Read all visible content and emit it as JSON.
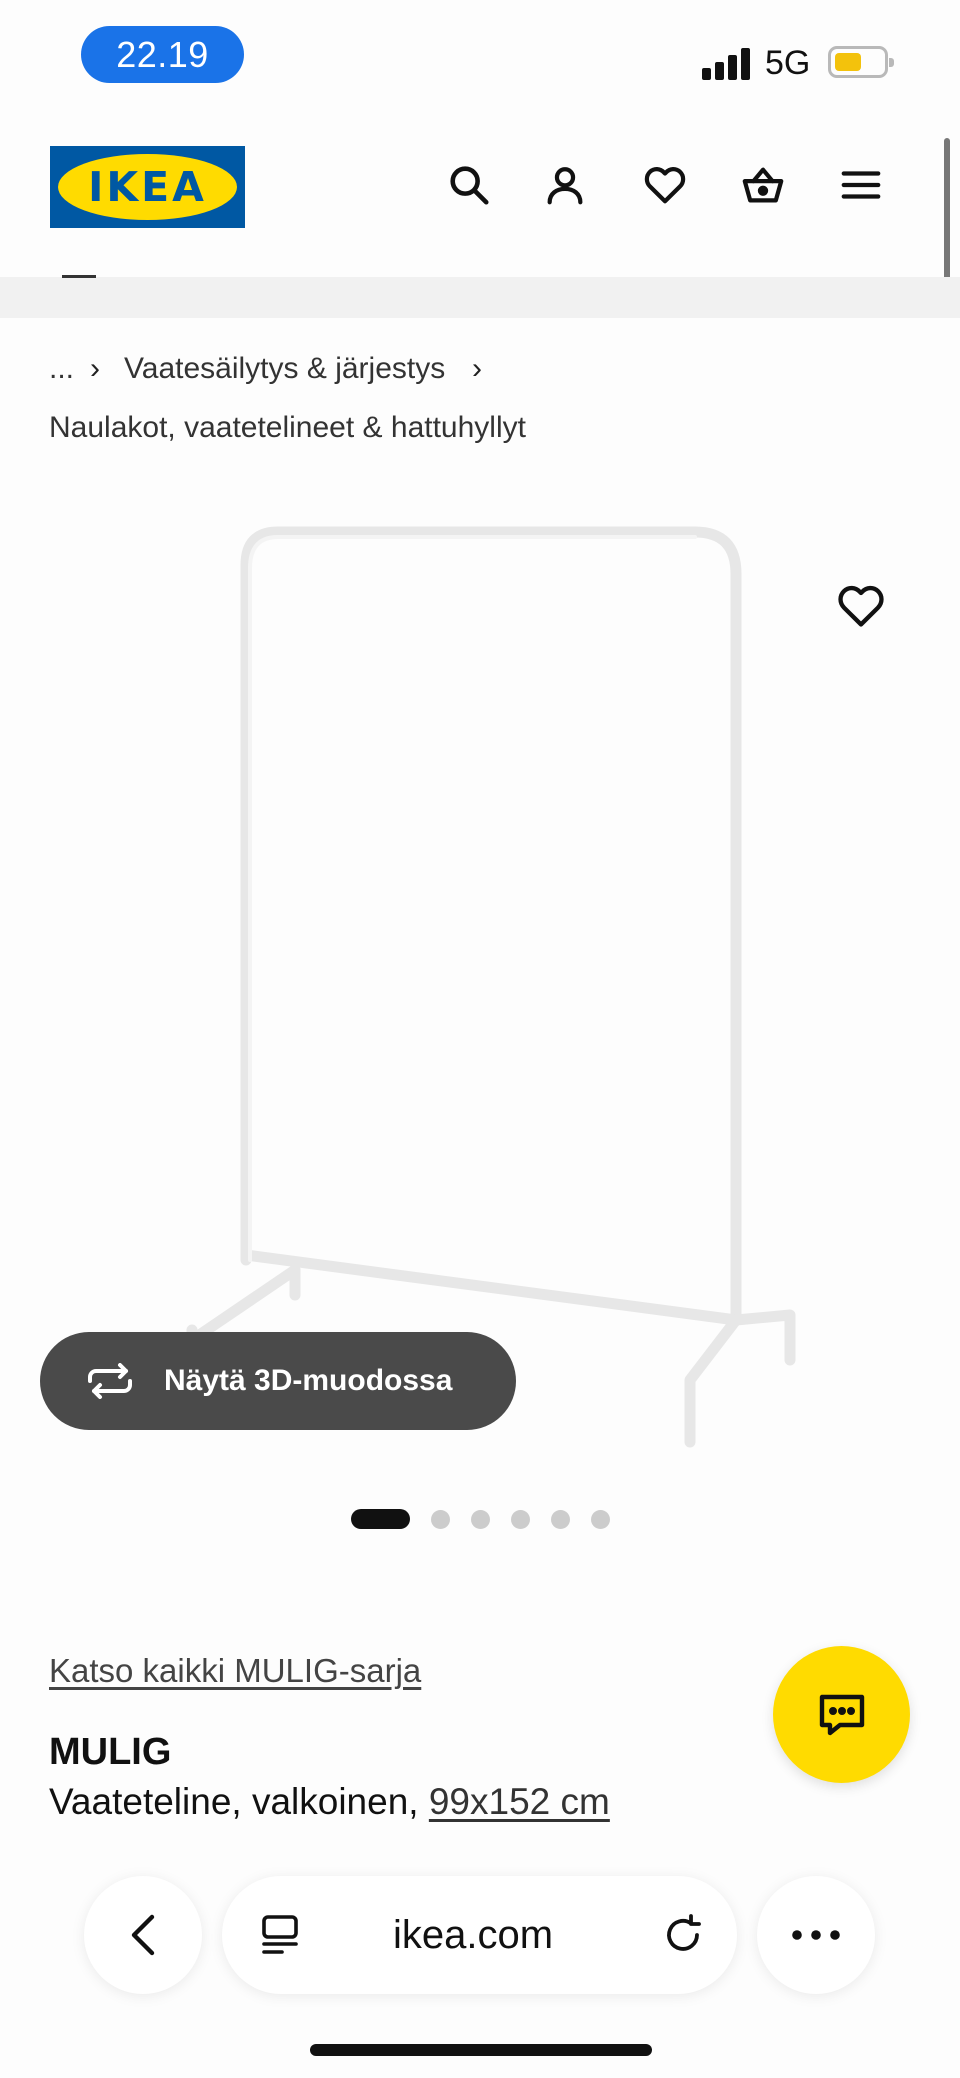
{
  "status_bar": {
    "time": "22.19",
    "network": "5G",
    "time_pill_color": "#1a73e8",
    "battery_color": "#f3c20c"
  },
  "header": {
    "logo_text": "IKEA",
    "brand_colors": {
      "blue": "#0058a3",
      "yellow": "#ffdb00"
    },
    "icons": [
      "search-icon",
      "account-icon",
      "wishlist-heart-icon",
      "shopping-basket-icon",
      "menu-hamburger-icon"
    ]
  },
  "breadcrumb": {
    "ellipsis": "...",
    "items": [
      "Vaatesäilytys & järjestys",
      "Naulakot, vaatetelineet & hattuhyllyt"
    ]
  },
  "product": {
    "view_3d_label": "Näytä 3D-muodossa",
    "carousel": {
      "total": 6,
      "active": 1
    },
    "series_link": "Katso kaikki MULIG-sarja",
    "name": "MULIG",
    "description": "Vaateteline, valkoinen, ",
    "size_link": "99x152 cm"
  },
  "browser": {
    "url": "ikea.com"
  }
}
